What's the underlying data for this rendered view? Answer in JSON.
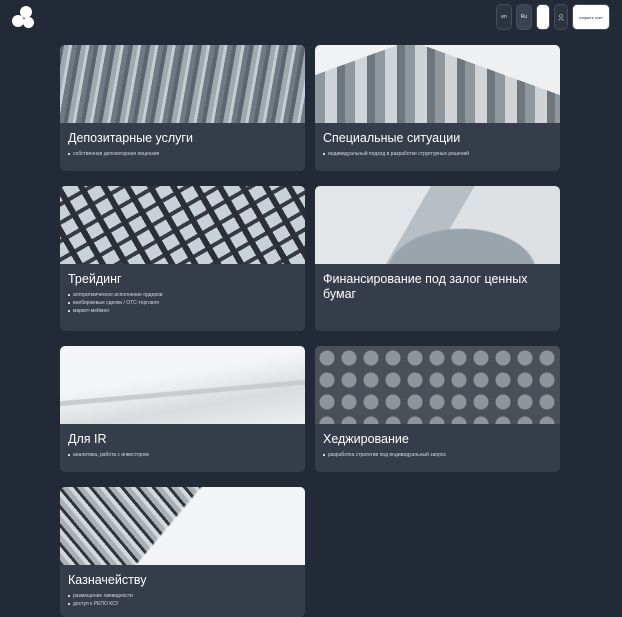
{
  "header": {
    "lang_en": "en",
    "lang_ru": "Ru",
    "lang_other": "",
    "cta_label": "открыть счет"
  },
  "services": [
    {
      "title": "Депозитарные услуги",
      "bullets": [
        "собственная депозитарная лицензия"
      ]
    },
    {
      "title": "Специальные ситуации",
      "bullets": [
        "индивидуальный подход в разработке структурных решений"
      ]
    },
    {
      "title": "Трейдинг",
      "bullets": [
        "алгоритмическое исполнение ордеров",
        "внебиржевые сделки / OTC-торговля",
        "маркет-мейкинг"
      ]
    },
    {
      "title": "Финансирование под залог ценных бумаг",
      "bullets": []
    },
    {
      "title": "Для IR",
      "bullets": [
        "аналитика, работа с инвестором"
      ]
    },
    {
      "title": "Хеджирование",
      "bullets": [
        "разработка стратегии под индивидуальный запрос"
      ]
    },
    {
      "title": "Казначейству",
      "bullets": [
        "размещение ликвидности",
        "доступ к РЕПО КСУ"
      ]
    }
  ]
}
